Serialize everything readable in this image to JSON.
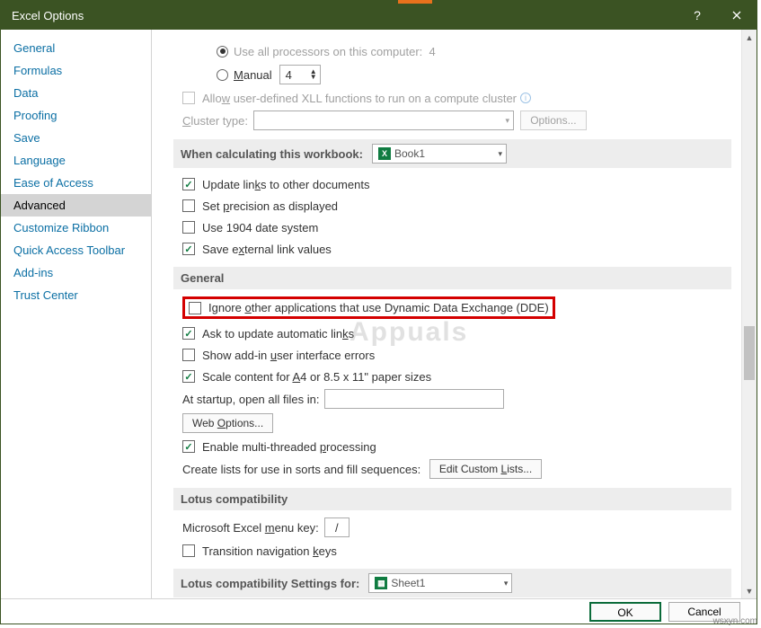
{
  "title": "Excel Options",
  "sidebar": {
    "items": [
      "General",
      "Formulas",
      "Data",
      "Proofing",
      "Save",
      "Language",
      "Ease of Access",
      "Advanced",
      "Customize Ribbon",
      "Quick Access Toolbar",
      "Add-ins",
      "Trust Center"
    ],
    "selected": "Advanced"
  },
  "formulas_top": {
    "use_all_processors": "Use all processors on this computer:",
    "processor_count": "4",
    "manual": "Manual",
    "manual_value": "4",
    "allow_xll": "Allow user-defined XLL functions to run on a compute cluster",
    "cluster_type": "Cluster type:",
    "options_btn": "Options..."
  },
  "section_workbook": {
    "head": "When calculating this workbook:",
    "book": "Book1",
    "update_links": "Update links to other documents",
    "set_precision": "Set precision as displayed",
    "use_1904": "Use 1904 date system",
    "save_external": "Save external link values"
  },
  "section_general": {
    "head": "General",
    "ignore_dde": "Ignore other applications that use Dynamic Data Exchange (DDE)",
    "ask_update": "Ask to update automatic links",
    "show_addin_err": "Show add-in user interface errors",
    "scale_content": "Scale content for A4 or 8.5 x 11\" paper sizes",
    "at_startup": "At startup, open all files in:",
    "web_options": "Web Options...",
    "multithread": "Enable multi-threaded processing",
    "create_lists": "Create lists for use in sorts and fill sequences:",
    "edit_lists": "Edit Custom Lists..."
  },
  "section_lotus": {
    "head": "Lotus compatibility",
    "menu_key": "Microsoft Excel menu key:",
    "menu_key_val": "/",
    "transition_nav": "Transition navigation keys"
  },
  "section_lotus_settings": {
    "head": "Lotus compatibility Settings for:",
    "sheet": "Sheet1"
  },
  "footer": {
    "ok": "OK",
    "cancel": "Cancel"
  },
  "watermark": "Appuals",
  "corner": "wsxyn.com"
}
